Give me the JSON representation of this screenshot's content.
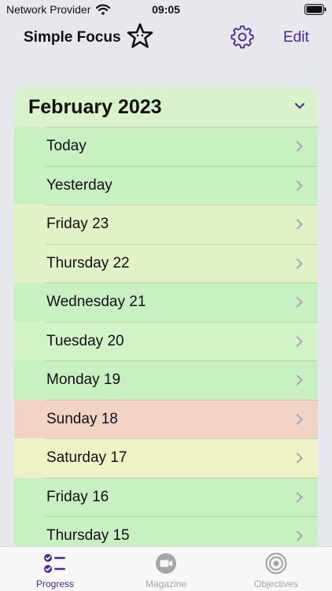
{
  "status_bar": {
    "carrier": "Network Provider",
    "time": "09:05"
  },
  "header": {
    "title": "Simple Focus",
    "edit_label": "Edit"
  },
  "month_section": {
    "title": "February 2023",
    "days": [
      {
        "label": "Today",
        "color": "#c8f0c2"
      },
      {
        "label": "Yesterday",
        "color": "#c8f0c2"
      },
      {
        "label": "Friday 23",
        "color": "#e0f2c6"
      },
      {
        "label": "Thursday 22",
        "color": "#e0f2c6"
      },
      {
        "label": "Wednesday 21",
        "color": "#c8f0c2"
      },
      {
        "label": "Tuesday 20",
        "color": "#d2f2c8"
      },
      {
        "label": "Monday 19",
        "color": "#c8f0c2"
      },
      {
        "label": "Sunday 18",
        "color": "#f2d4c6"
      },
      {
        "label": "Saturday 17",
        "color": "#eef2c4"
      },
      {
        "label": "Friday 16",
        "color": "#c8f0c2"
      },
      {
        "label": "Thursday 15",
        "color": "#c8f0c2"
      }
    ]
  },
  "tab_bar": {
    "tabs": [
      {
        "label": "Progress",
        "icon": "checklist-icon",
        "active": true
      },
      {
        "label": "Magazine",
        "icon": "video-camera-icon",
        "active": false
      },
      {
        "label": "Objectives",
        "icon": "target-icon",
        "active": false
      }
    ]
  },
  "colors": {
    "accent": "#4b2a8e"
  }
}
